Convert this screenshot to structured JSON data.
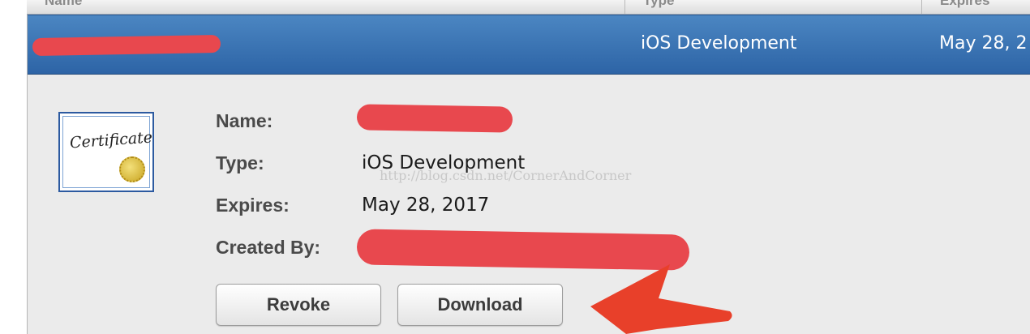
{
  "table": {
    "columns": [
      "Name",
      "Type",
      "Expires"
    ],
    "selected_row": {
      "type": "iOS Development",
      "expires": "May 28, 2"
    }
  },
  "certificate": {
    "icon_text": "Certificate",
    "icon": "certificate-icon"
  },
  "details": {
    "name_label": "Name:",
    "type_label": "Type:",
    "type_value": "iOS Development",
    "expires_label": "Expires:",
    "expires_value": "May 28, 2017",
    "created_by_label": "Created By:"
  },
  "watermark": "http://blog.csdn.net/CornerAndCorner",
  "buttons": {
    "revoke": "Revoke",
    "download": "Download"
  },
  "colors": {
    "selection": "#3a74b5",
    "redaction": "#e8484e",
    "annotation_arrow": "#e8402a"
  }
}
